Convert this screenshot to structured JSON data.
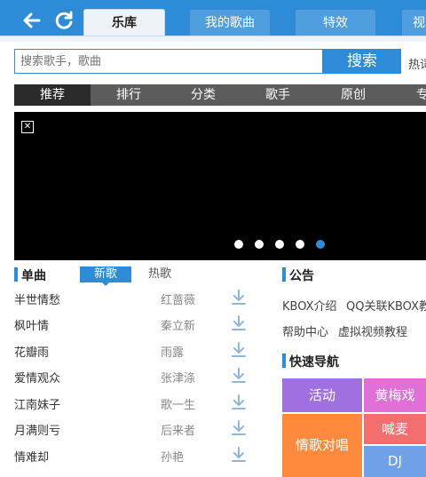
{
  "header": {
    "tabs": [
      {
        "label": "乐库"
      },
      {
        "label": "我的歌曲"
      },
      {
        "label": "特效"
      },
      {
        "label": "视"
      }
    ]
  },
  "search": {
    "placeholder": "搜索歌手，歌曲",
    "button_label": "搜索",
    "hot_label": "热词"
  },
  "categories": [
    {
      "label": "推荐"
    },
    {
      "label": "排行"
    },
    {
      "label": "分类"
    },
    {
      "label": "歌手"
    },
    {
      "label": "原创"
    },
    {
      "label": "专"
    }
  ],
  "banner": {
    "total_slides": 5,
    "active_slide": 5
  },
  "songs_section": {
    "title": "单曲",
    "tab_new": "新歌",
    "tab_hot": "热歌",
    "rows": [
      {
        "name": "半世情愁",
        "artist": "红蔷薇"
      },
      {
        "name": "枫叶情",
        "artist": "秦立新"
      },
      {
        "name": "花瓣雨",
        "artist": "雨露"
      },
      {
        "name": "爱情观众",
        "artist": "张津涤"
      },
      {
        "name": "江南妹子",
        "artist": "歌一生"
      },
      {
        "name": "月满则亏",
        "artist": "后来者"
      },
      {
        "name": "情难却",
        "artist": "孙艳"
      }
    ]
  },
  "notice": {
    "title": "公告",
    "links": [
      {
        "label": "KBOX介绍"
      },
      {
        "label": "QQ关联KBOX教"
      },
      {
        "label": "帮助中心"
      },
      {
        "label": "虚拟视频教程"
      }
    ]
  },
  "quicknav": {
    "title": "快速导航",
    "tiles": [
      {
        "label": "活动",
        "color": "#a070e0"
      },
      {
        "label": "黄梅戏",
        "color": "#e070d8"
      },
      {
        "label": "情歌对唱",
        "color": "#ff8a3d"
      },
      {
        "label": "喊麦",
        "color": "#f36f6f"
      },
      {
        "label": "DJ",
        "color": "#6fa0e8"
      }
    ]
  },
  "colors": {
    "accent": "#2d8bd8",
    "category_bar": "#5c5c5c"
  }
}
